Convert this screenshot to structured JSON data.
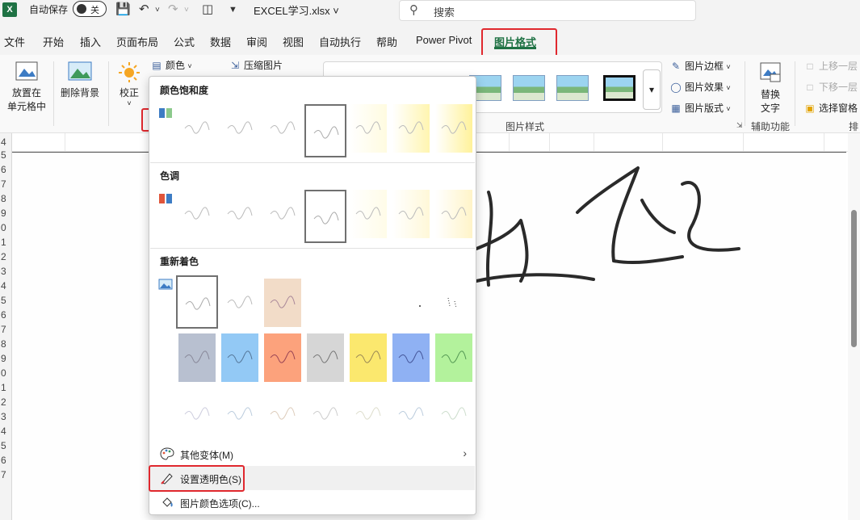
{
  "titlebar": {
    "autosave_label": "自动保存",
    "autosave_state": "关",
    "filename": "EXCEL学习.xlsx",
    "search_placeholder": "搜索"
  },
  "tabs": [
    "文件",
    "开始",
    "插入",
    "页面布局",
    "公式",
    "数据",
    "审阅",
    "视图",
    "自动执行",
    "帮助",
    "Power Pivot",
    "图片格式"
  ],
  "active_tab": "图片格式",
  "ribbon": {
    "place_in_cell": "放置在\n单元格中",
    "remove_background": "删除背景",
    "corrections": "校正",
    "color": "颜色",
    "compress": "压缩图片",
    "picture_border": "图片边框",
    "picture_effects": "图片效果",
    "picture_layout": "图片版式",
    "picture_styles_group": "图片样式",
    "alt_text": "替换\n文字",
    "accessibility_group": "辅助功能",
    "bring_forward": "上移一层",
    "send_backward": "下移一层",
    "selection_pane": "选择窗格",
    "arrange_group_partial": "排"
  },
  "row_numbers": [
    "4",
    "5",
    "6",
    "7",
    "8",
    "9",
    "0",
    "1",
    "2",
    "3",
    "4",
    "5",
    "6",
    "7",
    "8",
    "9",
    "0",
    "1",
    "2",
    "3",
    "4",
    "5",
    "6",
    "7"
  ],
  "color_menu": {
    "saturation_title": "颜色饱和度",
    "tone_title": "色调",
    "recolor_title": "重新着色",
    "more_variations": "其他变体(M)",
    "set_transparent": "设置透明色(S)",
    "picture_color_options": "图片颜色选项(C)...",
    "recolor_dark_colors": [
      "#b8c0d0",
      "#93c9f5",
      "#fca27c",
      "#d6d6d6",
      "#fbe86e",
      "#8fb1f3",
      "#b3f29c"
    ]
  },
  "colors": {
    "excel_green": "#1f7244",
    "highlight_red": "#e0282e"
  }
}
